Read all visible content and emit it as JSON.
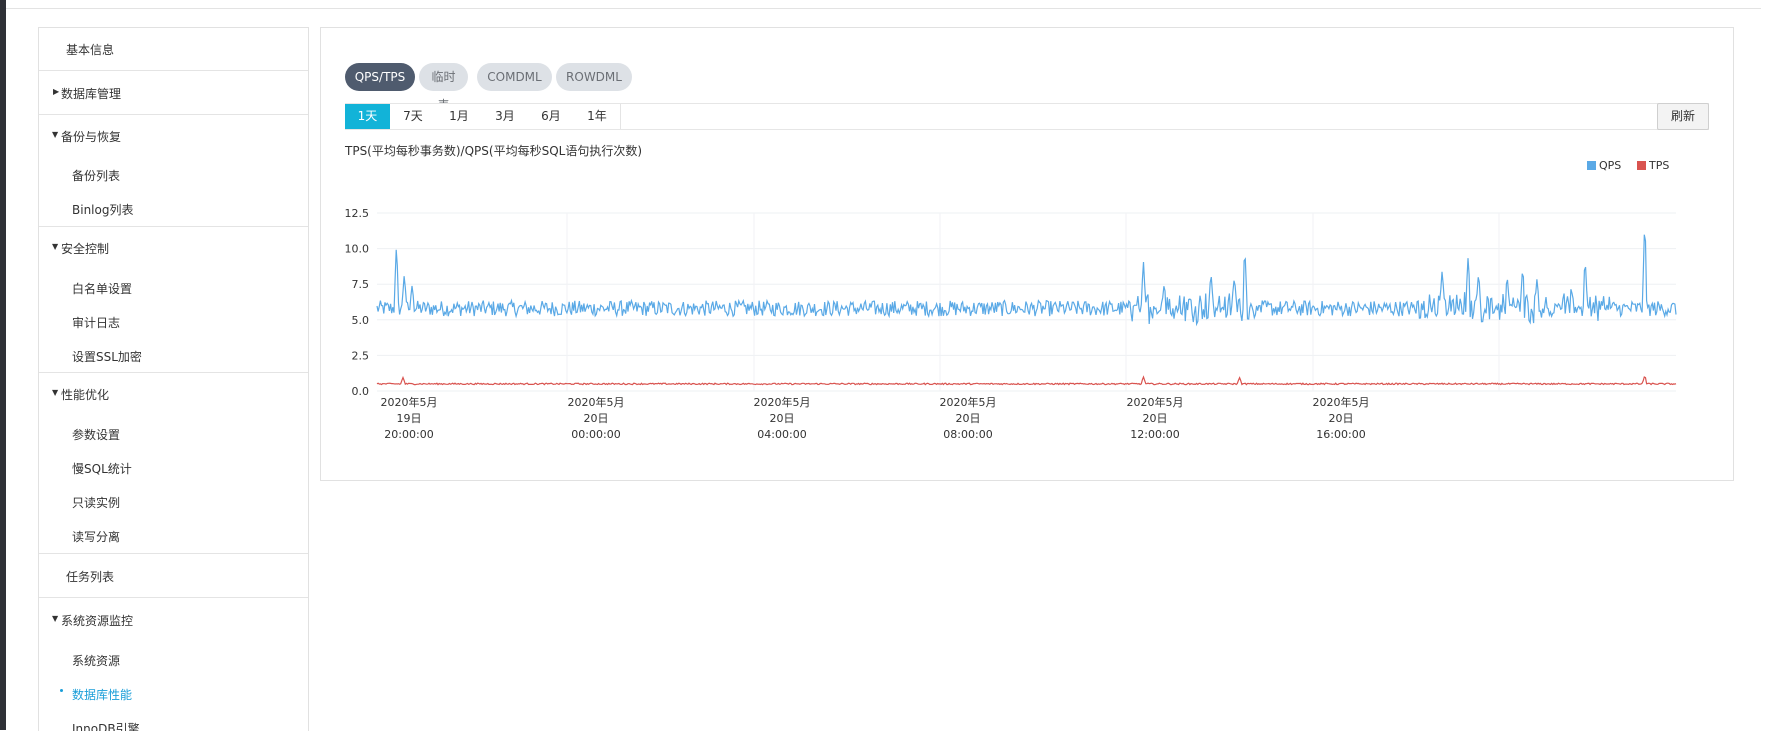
{
  "sidebar": {
    "items": [
      {
        "label": "基本信息"
      },
      {
        "label": "数据库管理"
      },
      {
        "label": "备份与恢复"
      },
      {
        "label": "备份列表"
      },
      {
        "label": "Binlog列表"
      },
      {
        "label": "安全控制"
      },
      {
        "label": "白名单设置"
      },
      {
        "label": "审计日志"
      },
      {
        "label": "设置SSL加密"
      },
      {
        "label": "性能优化"
      },
      {
        "label": "参数设置"
      },
      {
        "label": "慢SQL统计"
      },
      {
        "label": "只读实例"
      },
      {
        "label": "读写分离"
      },
      {
        "label": "任务列表"
      },
      {
        "label": "系统资源监控"
      },
      {
        "label": "系统资源"
      },
      {
        "label": "数据库性能"
      },
      {
        "label": "InnoDB引擎"
      }
    ]
  },
  "metric_tabs": [
    "QPS/TPS",
    "临时表",
    "COMDML",
    "ROWDML"
  ],
  "range_buttons": [
    "1天",
    "7天",
    "1月",
    "3月",
    "6月",
    "1年"
  ],
  "refresh_label": "刷新",
  "chart_title": "TPS(平均每秒事务数)/QPS(平均每秒SQL语句执行次数)",
  "colors": {
    "qps": "#5aa9e6",
    "tps": "#d9534f",
    "active_range": "#12b3d8",
    "active_tab": "#4f5b6e",
    "active_nav": "#1a9ed8"
  },
  "chart_data": {
    "type": "line",
    "legend": "top-right",
    "grid": true,
    "y_ticks": [
      "12.5",
      "10.0",
      "7.5",
      "5.0",
      "2.5",
      "0.0"
    ],
    "ylim": [
      0,
      12.5
    ],
    "x_tick_labels": [
      {
        "line1": "2020年5月",
        "line2": "19日",
        "line3": "20:00:00"
      },
      {
        "line1": "2020年5月",
        "line2": "20日",
        "line3": "00:00:00"
      },
      {
        "line1": "2020年5月",
        "line2": "20日",
        "line3": "04:00:00"
      },
      {
        "line1": "2020年5月",
        "line2": "20日",
        "line3": "08:00:00"
      },
      {
        "line1": "2020年5月",
        "line2": "20日",
        "line3": "12:00:00"
      },
      {
        "line1": "2020年5月",
        "line2": "20日",
        "line3": "16:00:00"
      }
    ],
    "series": [
      {
        "name": "QPS",
        "baseline": 5.8,
        "noise": 0.55,
        "spikes": [
          [
            0.015,
            10.4
          ],
          [
            0.021,
            8.2
          ],
          [
            0.027,
            7.4
          ],
          [
            0.59,
            9.2
          ],
          [
            0.606,
            7.6
          ],
          [
            0.642,
            8.4
          ],
          [
            0.66,
            8.1
          ],
          [
            0.668,
            10.2
          ],
          [
            0.82,
            8.6
          ],
          [
            0.84,
            9.6
          ],
          [
            0.848,
            8.4
          ],
          [
            0.87,
            8.2
          ],
          [
            0.882,
            8.8
          ],
          [
            0.893,
            7.9
          ],
          [
            0.93,
            9.4
          ],
          [
            0.976,
            12.2
          ]
        ]
      },
      {
        "name": "TPS",
        "baseline": 0.5,
        "noise": 0.05,
        "spikes": [
          [
            0.02,
            0.95
          ],
          [
            0.59,
            1.0
          ],
          [
            0.664,
            0.95
          ],
          [
            0.976,
            1.1
          ]
        ]
      }
    ]
  }
}
